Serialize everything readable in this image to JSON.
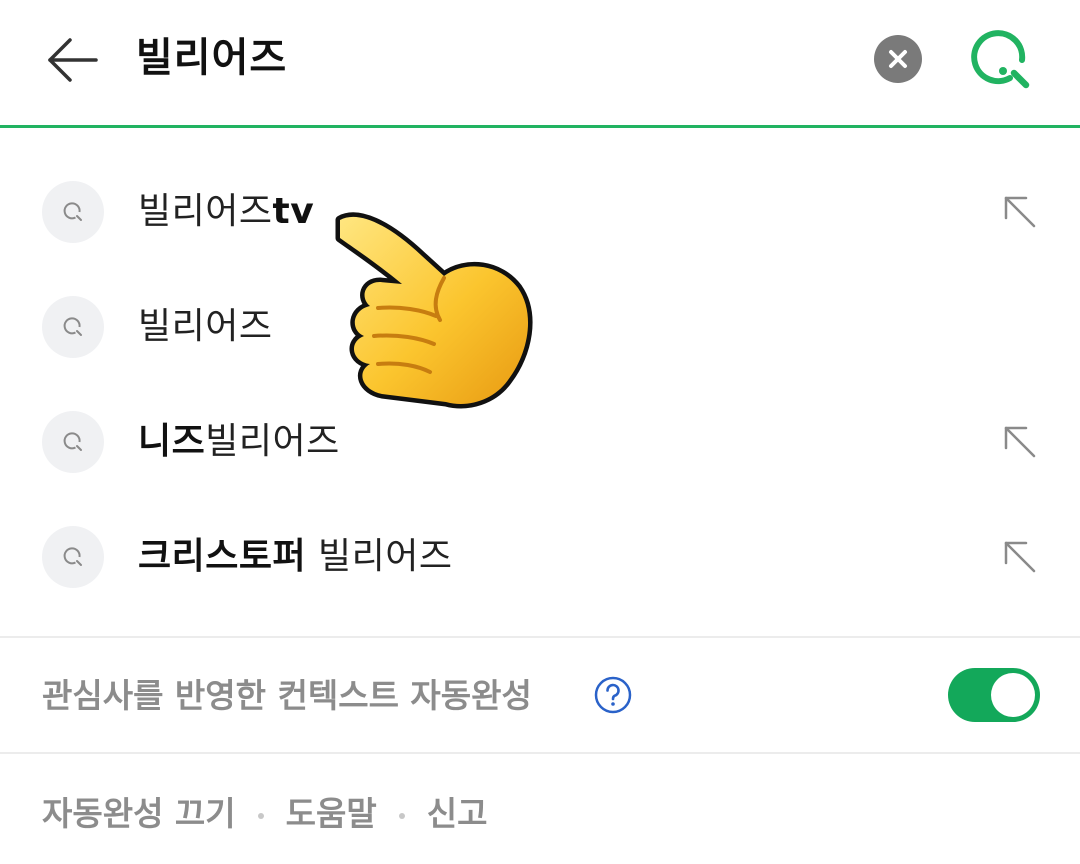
{
  "search": {
    "query": "빌리어즈",
    "back_icon": "arrow-left-icon",
    "clear_icon": "clear-x-icon",
    "search_icon": "search-icon",
    "accent_color": "#21b361"
  },
  "suggestions": [
    {
      "bold_prefix": "",
      "normal": "빌리어즈",
      "bold_suffix": "tv",
      "has_fill_arrow": true
    },
    {
      "bold_prefix": "",
      "normal": "빌리어즈",
      "bold_suffix": "",
      "has_fill_arrow": false
    },
    {
      "bold_prefix": "니즈",
      "normal": "빌리어즈",
      "bold_suffix": "",
      "has_fill_arrow": true
    },
    {
      "bold_prefix": "크리스토퍼",
      "normal": " 빌리어즈",
      "bold_suffix": "",
      "has_fill_arrow": true
    }
  ],
  "context_autocomplete": {
    "label": "관심사를 반영한 컨텍스트 자동완성",
    "help_icon": "question-circle-icon",
    "toggle_on": true,
    "toggle_color": "#13a85a"
  },
  "footer": {
    "links": [
      "자동완성 끄기",
      "도움말",
      "신고"
    ]
  },
  "overlay": {
    "icon": "pointing-hand-icon"
  }
}
